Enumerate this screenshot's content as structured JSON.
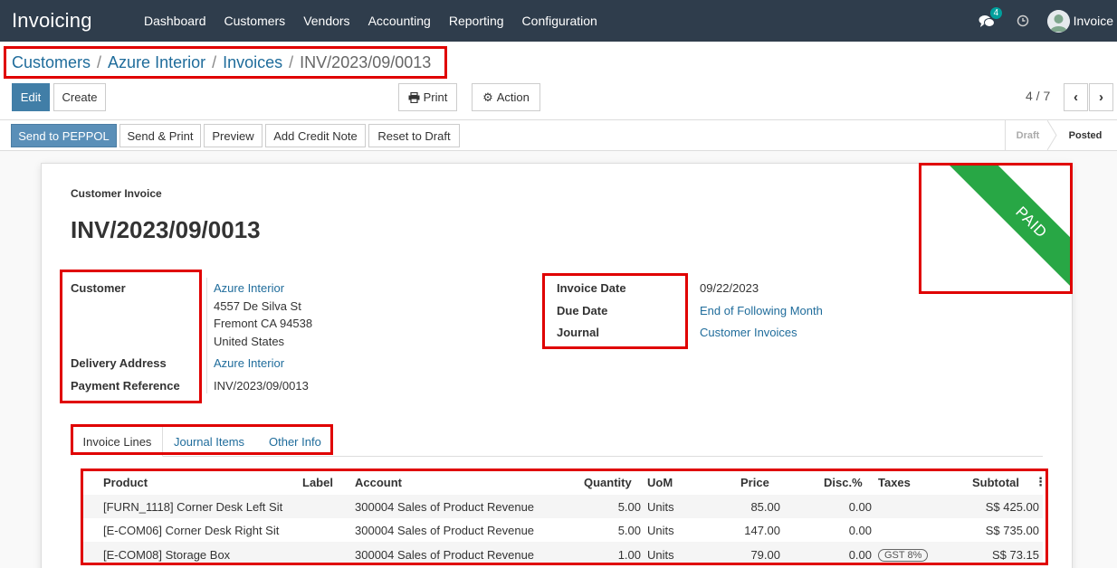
{
  "nav": {
    "brand": "Invoicing",
    "menu": [
      "Dashboard",
      "Customers",
      "Vendors",
      "Accounting",
      "Reporting",
      "Configuration"
    ],
    "chat_count": "4",
    "user": "Invoice"
  },
  "breadcrumb": [
    "Customers",
    "Azure Interior",
    "Invoices",
    "INV/2023/09/0013"
  ],
  "control": {
    "edit": "Edit",
    "create": "Create",
    "print": "Print",
    "action": "Action",
    "pager": "4 / 7"
  },
  "statusbar": {
    "buttons": [
      "Send to PEPPOL",
      "Send & Print",
      "Preview",
      "Add Credit Note",
      "Reset to Draft"
    ],
    "stages": [
      "Draft",
      "Posted"
    ],
    "active_stage": "Posted"
  },
  "invoice": {
    "type": "Customer Invoice",
    "number": "INV/2023/09/0013",
    "ribbon": "PAID",
    "customer_label": "Customer",
    "customer_name": "Azure Interior",
    "address": [
      "4557 De Silva St",
      "Fremont CA 94538",
      "United States"
    ],
    "delivery_label": "Delivery Address",
    "delivery_value": "Azure Interior",
    "payref_label": "Payment Reference",
    "payref_value": "INV/2023/09/0013",
    "invoice_date_label": "Invoice Date",
    "invoice_date": "09/22/2023",
    "due_date_label": "Due Date",
    "due_date": "End of Following Month",
    "journal_label": "Journal",
    "journal": "Customer Invoices"
  },
  "tabs": [
    "Invoice Lines",
    "Journal Items",
    "Other Info"
  ],
  "lines": {
    "headers": [
      "Product",
      "Label",
      "Account",
      "Quantity",
      "UoM",
      "Price",
      "Disc.%",
      "Taxes",
      "Subtotal"
    ],
    "rows": [
      {
        "product": "[FURN_1118] Corner Desk Left Sit",
        "account": "300004 Sales of Product Revenue",
        "qty": "5.00",
        "uom": "Units",
        "price": "85.00",
        "disc": "0.00",
        "tax": "",
        "subtotal": "S$ 425.00"
      },
      {
        "product": "[E-COM06] Corner Desk Right Sit",
        "account": "300004 Sales of Product Revenue",
        "qty": "5.00",
        "uom": "Units",
        "price": "147.00",
        "disc": "0.00",
        "tax": "",
        "subtotal": "S$ 735.00"
      },
      {
        "product": "[E-COM08] Storage Box",
        "account": "300004 Sales of Product Revenue",
        "qty": "1.00",
        "uom": "Units",
        "price": "79.00",
        "disc": "0.00",
        "tax": "GST 8%",
        "subtotal": "S$ 73.15"
      }
    ]
  },
  "colors": {
    "navbar": "#2f3d4c",
    "link": "#1f6c9b",
    "primary": "#417ea7",
    "paid": "#28a745",
    "highlight": "#e00000"
  }
}
